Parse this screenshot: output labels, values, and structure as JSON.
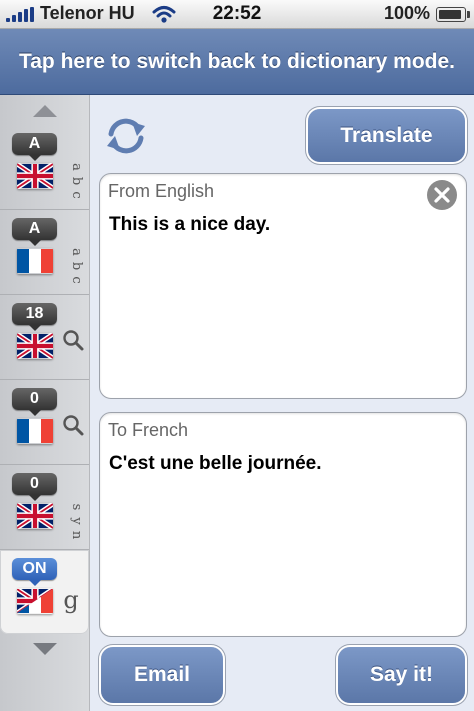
{
  "status_bar": {
    "carrier": "Telenor HU",
    "time": "22:52",
    "battery": "100%",
    "battery_level": 1.0
  },
  "banner": {
    "text": "Tap here to switch back to dictionary mode."
  },
  "sidebar": {
    "items": [
      {
        "badge": "A",
        "flag": "uk-flag",
        "mode_icon": "abc-icon",
        "active": false
      },
      {
        "badge": "A",
        "flag": "france-flag",
        "mode_icon": "abc-icon",
        "active": false
      },
      {
        "badge": "18",
        "flag": "uk-flag",
        "mode_icon": "magnifier-icon",
        "active": false
      },
      {
        "badge": "0",
        "flag": "france-flag",
        "mode_icon": "magnifier-icon",
        "active": false
      },
      {
        "badge": "0",
        "flag": "uk-flag",
        "mode_icon": "syn-icon",
        "active": false
      },
      {
        "badge": "ON",
        "flag": "uk-france-flag",
        "mode_icon": "google-g-icon",
        "active": true
      }
    ]
  },
  "toolbar": {
    "translate_label": "Translate",
    "sync_icon": "refresh-icon"
  },
  "source": {
    "label": "From English",
    "text": "This is a nice day."
  },
  "target": {
    "label": "To French",
    "text": "C'est une belle journée."
  },
  "actions": {
    "email_label": "Email",
    "say_label": "Say it!"
  },
  "colors": {
    "accent": "#5b77a8",
    "banner": "#5a76a6",
    "background": "#e6ebf5"
  }
}
